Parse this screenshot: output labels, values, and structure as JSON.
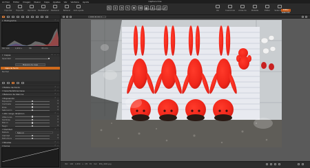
{
  "app": {
    "title": "Capture One"
  },
  "menu": [
    "Archivo",
    "Editar",
    "Imagen",
    "Nuevo",
    "Capa",
    "Ajustes",
    "Ver",
    "Ventana",
    "Ayuda"
  ],
  "toolbar": {
    "left_items": [
      "Importar",
      "Exportar",
      "Opciones",
      "Restablecer",
      "Deshacer",
      "Rehacer",
      "Auto ajuste"
    ],
    "cursor_tools_label": "Herramientas de cursor",
    "tools": [
      "pointer-tool",
      "crop-tool",
      "levels-tool",
      "color-picker-tool",
      "brush-tool",
      "eraser-tool",
      "gradient-tool",
      "heal-tool",
      "clone-tool",
      "annotate-tool"
    ],
    "right_items": [
      "Ver",
      "Cuadrícula",
      "Antes de",
      "Pantalla",
      "Editar",
      "Seleccionar"
    ],
    "select_edit": "Editar selección"
  },
  "left_panel": {
    "histogram_title": "Histograma",
    "histogram_iso": "ISO 100",
    "histogram_shutter": "1/250 s",
    "histogram_aperture": "f/8",
    "histogram_focal": "35 mm",
    "layers_title": "Capas",
    "opacity_label": "Opacidad",
    "layer_button": "Máscara de capa",
    "layer_selected": "Capa de fondo",
    "layer_mode": "Normal",
    "sections": [
      "Estilos de fondo",
      "Características base",
      "Balance de blancos",
      "Exposición",
      "Alto rango dinámico",
      "Claridad",
      "Niveles",
      "Curva"
    ],
    "exposure_rows": [
      {
        "label": "Exposición",
        "value": "0"
      },
      {
        "label": "Contraste",
        "value": "0"
      },
      {
        "label": "Brillo",
        "value": "0"
      },
      {
        "label": "Saturación",
        "value": "0"
      }
    ],
    "hdr_rows": [
      {
        "label": "Altas luces",
        "value": "0"
      },
      {
        "label": "Sombras",
        "value": "0"
      },
      {
        "label": "Blanco",
        "value": "0"
      },
      {
        "label": "Negro",
        "value": "0"
      }
    ],
    "clarity_rows": [
      {
        "label": "Método",
        "value": "Natural"
      },
      {
        "label": "Claridad",
        "value": "0"
      },
      {
        "label": "Estructura",
        "value": "0"
      }
    ]
  },
  "viewer": {
    "file_name": "Vista de foto 1",
    "status": "ISO 100   1/250 s   f/8   35 mm   IMG_4021.jpg"
  },
  "colors": {
    "accent": "#d06a1c",
    "panel": "#323232",
    "viewer_bg": "#5a5a5a"
  }
}
